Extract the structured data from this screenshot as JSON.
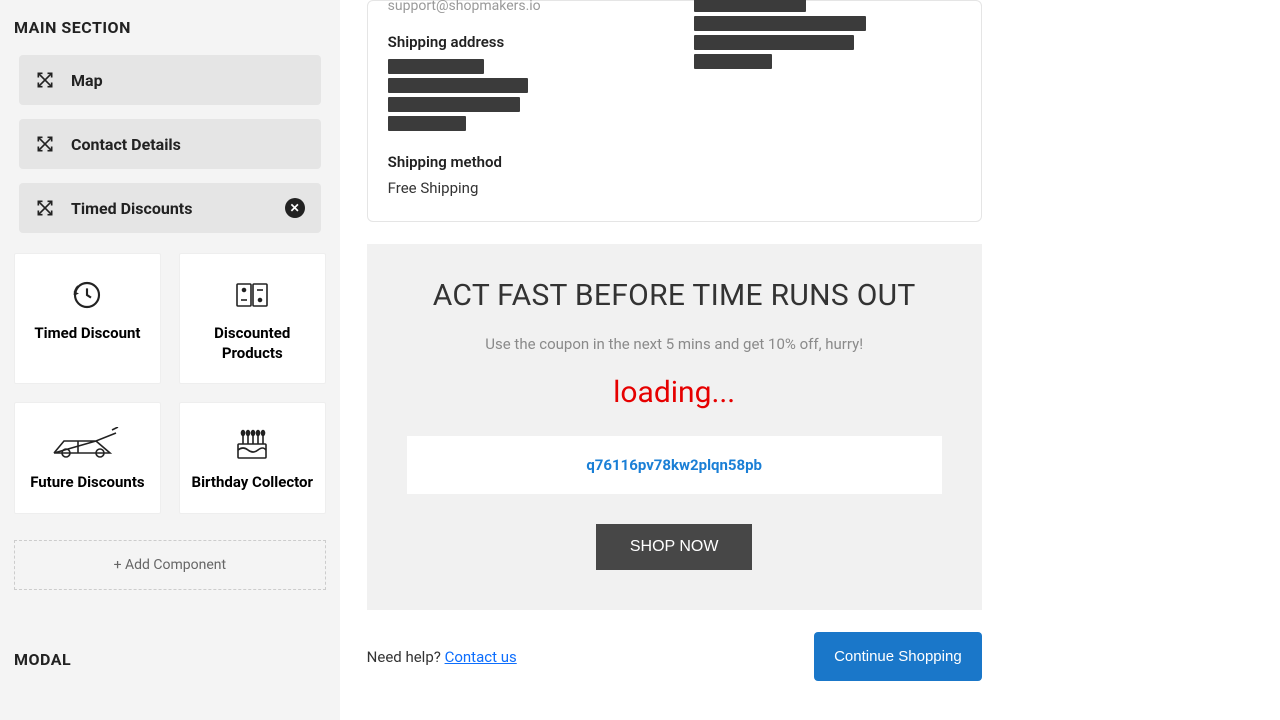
{
  "sidebar": {
    "main_heading": "MAIN SECTION",
    "modal_heading": "MODAL",
    "items": [
      {
        "label": "Map",
        "closable": false
      },
      {
        "label": "Contact Details",
        "closable": false
      },
      {
        "label": "Timed Discounts",
        "closable": true
      }
    ],
    "cards": [
      {
        "title": "Timed Discount",
        "icon": "clock-back-icon"
      },
      {
        "title": "Discounted Products",
        "icon": "coupon-icon"
      },
      {
        "title": "Future Discounts",
        "icon": "delorean-icon"
      },
      {
        "title": "Birthday Collector",
        "icon": "cake-icon"
      }
    ],
    "add_label": "+ Add Component"
  },
  "order": {
    "truncated_email": "support@shopmakers.io",
    "shipping_address_label": "Shipping address",
    "shipping_method_label": "Shipping method",
    "shipping_method_value": "Free Shipping"
  },
  "promo": {
    "headline": "ACT FAST BEFORE TIME RUNS OUT",
    "sub": "Use the coupon in the next 5 mins and get 10% off, hurry!",
    "loading_text": "loading...",
    "code": "q76116pv78kw2plqn58pb",
    "button_label": "SHOP NOW"
  },
  "footer": {
    "help_text": "Need help? ",
    "contact_link": "Contact us",
    "continue_label": "Continue Shopping"
  }
}
